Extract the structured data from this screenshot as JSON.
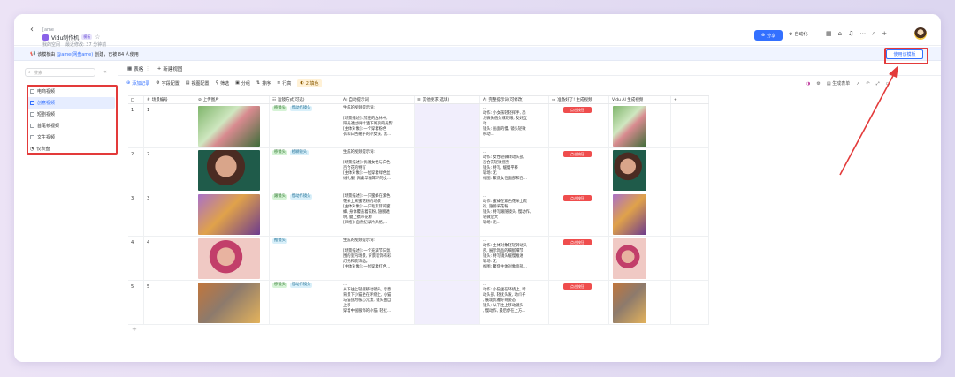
{
  "topbar": {
    "back_icon": "chevron-left-icon",
    "breadcrumb_small": "[ame",
    "title": "Vidu制作机",
    "title_badge": "模板",
    "location": "我的空间",
    "last_modified": "最近修改: 37 分钟前",
    "share_label": "分享",
    "automation_label": "自动化"
  },
  "banner": {
    "text_prefix": "该模板由",
    "author": "@ame(网盘ame)",
    "text_suffix": "创建，已被 84 人使用",
    "use_button": "使用该模板"
  },
  "sidebar": {
    "search_placeholder": "搜索",
    "items": [
      {
        "label": "电商视频",
        "active": false
      },
      {
        "label": "创意视频",
        "active": true
      },
      {
        "label": "短剧视频",
        "active": false
      },
      {
        "label": "首尾帧视频",
        "active": false
      },
      {
        "label": "文生视频",
        "active": false
      },
      {
        "label": "仪表盘",
        "active": false
      }
    ]
  },
  "tabs": {
    "active": "表格",
    "new_view": "新建视图"
  },
  "toolbar": {
    "add_record": "添加记录",
    "field_config": "字段配置",
    "view_config": "视图配置",
    "filter": "筛选",
    "group": "分组",
    "sort": "排序",
    "row_height": "行高",
    "group_fill": "2 填色",
    "generate_form": "生成表单"
  },
  "columns": [
    "场景编号",
    "上传图片",
    "运镜方式(可选)",
    "自动提示词",
    "其他要求(选填)",
    "完整提示词(可修改)",
    "准备好了! 生成视频",
    "Vidu AI 生成视频"
  ],
  "rows": [
    {
      "no": "1",
      "idx": "1",
      "tags": [
        {
          "text": "移镜头",
          "color": "g"
        },
        {
          "text": "慢动作镜头",
          "color": "b"
        }
      ],
      "auto_prompt": "生成的视频提示词:\n\n[场景描述]: 茂密的丛林中,\n阳光透过树叶洒下斑驳的光影\n[主体对象]: 一个穿着粉色\n衣和白色裙子的小女孩, 黑...",
      "full_prompt": "...\n动作: 小女孩轻轻挥手, 恐\n龙微微低头或眨眼, 友好互\n动\n镜头: 画面的慢, 镜头轻微\n移动...",
      "button": "点击按钮"
    },
    {
      "no": "2",
      "idx": "2",
      "tags": [
        {
          "text": "移镜头",
          "color": "g"
        },
        {
          "text": "模糊镜头",
          "color": "b"
        }
      ],
      "auto_prompt": "生成的视频提示词:\n\n[场景描述]: 优雅女性与白色\n百合花的特写\n[主体对象]: 一位穿着绿色丝\n绒礼服, 佩戴华丽耳环的女...",
      "full_prompt": "...\n动作: 女性轻微转动头部,\n百合花轻微摇曳\n镜头: 特写, 缓慢平移\n转场: 无\n构图: 聚焦女性面部和百...",
      "button": "点击按钮"
    },
    {
      "no": "3",
      "idx": "3",
      "tags": [
        {
          "text": "跟镜头",
          "color": "g"
        },
        {
          "text": "慢动作镜头",
          "color": "b"
        }
      ],
      "auto_prompt": "[场景描述]: 一只蜜蜂在紫色\n花朵上采蜜花粉的场景\n[主体对象]: 一只毛茸茸的蜜\n蜂, 身体覆盖着花粉, 翅膀透\n明, 腿上携带花粉\n[风格]: 自然纪录片风格,...",
      "full_prompt": "...\n动作: 蜜蜂在紫色花朵上爬\n行, 翅膀采花粉\n镜头: 特写跟随镜头, 慢动作,\n轻微放大\n转场: 无...",
      "button": "点击按钮"
    },
    {
      "no": "4",
      "idx": "4",
      "tags": [
        {
          "text": "推镜头",
          "color": "b"
        }
      ],
      "auto_prompt": "生成的视频提示词:\n\n[场景描述]: 一个充满节日氛\n围的室内场景, 背景装饰有彩\n灯光和装饰品。\n[主体对象]: 一位穿着红色...",
      "full_prompt": "...\n动作: 主体对象轻轻转动头\n部, 展示饰品的细腻细节\n镜头: 特写镜头缓慢推进\n转场: 无\n构图: 聚焦主体对象面部...",
      "button": "点击按钮"
    },
    {
      "no": "5",
      "idx": "5",
      "tags": [
        {
          "text": "移镜头",
          "color": "g"
        },
        {
          "text": "慢动作镜头",
          "color": "b"
        }
      ],
      "auto_prompt": "...\n从下往上轻摇移动镜头, 示意\n背景下小猫坐在环绕上, 小猫\n与猫弦为核心元素, 镜头由自\n上移\n穿着中国服饰的小猫, 轻抚...",
      "full_prompt": "...\n动作: 小猫坐在环绕上, 转\n动头部, 轻抚头发, 动爪子\n, 展现优雅好奇姿态\n镜头: 从下往上移动镜头\n, 慢动作, 最后停在上方...",
      "button": "点击按钮"
    }
  ],
  "colors": {
    "accent": "#3370ff",
    "annotation": "#e33a3a",
    "button_red": "#ef4d4d"
  }
}
